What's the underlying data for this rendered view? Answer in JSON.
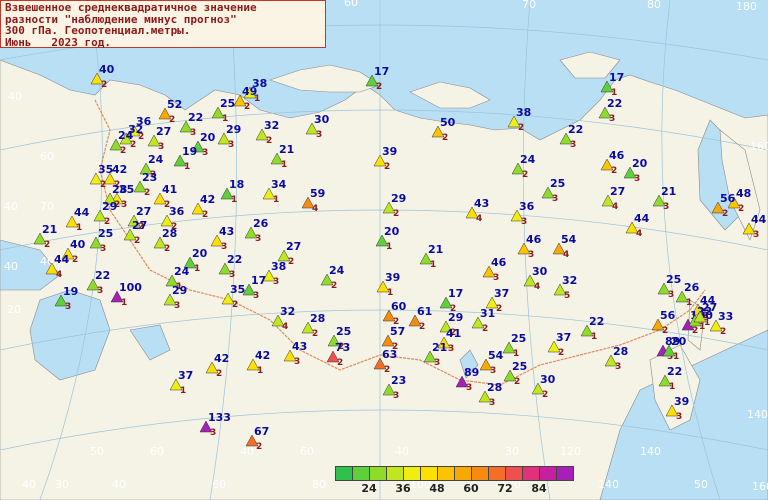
{
  "title": {
    "line1": "Взвешенное среднеквадратичное значение",
    "line2": "разности \"наблюдение минус прогноз\"",
    "line3": "300 гПа. Геопотенциал.метры.",
    "line4": "Июнь   2023 год."
  },
  "legend": {
    "colors": [
      "#2fc24a",
      "#5ed03a",
      "#8fdb2a",
      "#bfe61e",
      "#eeee10",
      "#fde000",
      "#fcc300",
      "#f9a800",
      "#f78b10",
      "#f46e25",
      "#ef4f4f",
      "#e2307a",
      "#c81fa0",
      "#a81fb8"
    ],
    "labels": [
      "24",
      "36",
      "48",
      "60",
      "72",
      "84"
    ]
  },
  "graticule_labels": [
    "60",
    "20",
    "70",
    "80",
    "180",
    "160",
    "140",
    "160",
    "40",
    "40",
    "40",
    "60",
    "40",
    "30",
    "20",
    "40",
    "60",
    "80",
    "100",
    "120",
    "140",
    "50",
    "60",
    "70",
    "40",
    "50",
    "60",
    "40",
    "60",
    "40",
    "30",
    "120",
    "140"
  ],
  "stations": [
    {
      "v": "40",
      "c": "2"
    },
    {
      "v": "52",
      "c": "2"
    },
    {
      "v": "25",
      "c": "1"
    },
    {
      "v": "38",
      "c": "1"
    },
    {
      "v": "49",
      "c": "2"
    },
    {
      "v": "17",
      "c": "2"
    },
    {
      "v": "17",
      "c": "1"
    },
    {
      "v": "36",
      "c": "2"
    },
    {
      "v": "22",
      "c": "3"
    },
    {
      "v": "32",
      "c": "2"
    },
    {
      "v": "27",
      "c": "3"
    },
    {
      "v": "20",
      "c": "3"
    },
    {
      "v": "29",
      "c": "3"
    },
    {
      "v": "30",
      "c": "3"
    },
    {
      "v": "38",
      "c": "2"
    },
    {
      "v": "50",
      "c": "2"
    },
    {
      "v": "22",
      "c": "3"
    },
    {
      "v": "22",
      "c": "3"
    },
    {
      "v": "32",
      "c": "2"
    },
    {
      "v": "24",
      "c": "2"
    },
    {
      "v": "24",
      "c": "2"
    },
    {
      "v": "19",
      "c": "1"
    },
    {
      "v": "21",
      "c": "1"
    },
    {
      "v": "39",
      "c": "2"
    },
    {
      "v": "24",
      "c": "2"
    },
    {
      "v": "46",
      "c": "2"
    },
    {
      "v": "20",
      "c": "3"
    },
    {
      "v": "42",
      "c": "2"
    },
    {
      "v": "35",
      "c": "2"
    },
    {
      "v": "23",
      "c": "2"
    },
    {
      "v": "41",
      "c": "2"
    },
    {
      "v": "18",
      "c": "1"
    },
    {
      "v": "34",
      "c": "1"
    },
    {
      "v": "25",
      "c": "3"
    },
    {
      "v": "35",
      "c": "3"
    },
    {
      "v": "28",
      "c": "2"
    },
    {
      "v": "27",
      "c": "4"
    },
    {
      "v": "21",
      "c": "3"
    },
    {
      "v": "48",
      "c": "2"
    },
    {
      "v": "59",
      "c": "4"
    },
    {
      "v": "29",
      "c": "2"
    },
    {
      "v": "56",
      "c": "2"
    },
    {
      "v": "29",
      "c": "2"
    },
    {
      "v": "42",
      "c": "2"
    },
    {
      "v": "43",
      "c": "4"
    },
    {
      "v": "36",
      "c": "3"
    },
    {
      "v": "44",
      "c": "4"
    },
    {
      "v": "44",
      "c": "1"
    },
    {
      "v": "27",
      "c": "2"
    },
    {
      "v": "36",
      "c": "2"
    },
    {
      "v": "44",
      "c": "3"
    },
    {
      "v": "21",
      "c": "2"
    },
    {
      "v": "40",
      "c": "2"
    },
    {
      "v": "25",
      "c": "3"
    },
    {
      "v": "27",
      "c": "2"
    },
    {
      "v": "28",
      "c": "2"
    },
    {
      "v": "43",
      "c": "3"
    },
    {
      "v": "20",
      "c": "1"
    },
    {
      "v": "21",
      "c": "1"
    },
    {
      "v": "46",
      "c": "3"
    },
    {
      "v": "54",
      "c": "4"
    },
    {
      "v": "26",
      "c": "3"
    },
    {
      "v": "44",
      "c": "4"
    },
    {
      "v": "20",
      "c": "1"
    },
    {
      "v": "27",
      "c": "2"
    },
    {
      "v": "22",
      "c": "3"
    },
    {
      "v": "24",
      "c": "1"
    },
    {
      "v": "38",
      "c": "3"
    },
    {
      "v": "22",
      "c": "3"
    },
    {
      "v": "24",
      "c": "2"
    },
    {
      "v": "39",
      "c": "1"
    },
    {
      "v": "46",
      "c": "3"
    },
    {
      "v": "30",
      "c": "4"
    },
    {
      "v": "32",
      "c": "5"
    },
    {
      "v": "25",
      "c": "3"
    },
    {
      "v": "26",
      "c": "1"
    },
    {
      "v": "19",
      "c": "3"
    },
    {
      "v": "100",
      "c": "1"
    },
    {
      "v": "29",
      "c": "3"
    },
    {
      "v": "35",
      "c": "2"
    },
    {
      "v": "17",
      "c": "3"
    },
    {
      "v": "17",
      "c": "2"
    },
    {
      "v": "37",
      "c": "2"
    },
    {
      "v": "44",
      "c": "2"
    },
    {
      "v": "32",
      "c": "4"
    },
    {
      "v": "60",
      "c": "2"
    },
    {
      "v": "61",
      "c": "2"
    },
    {
      "v": "29",
      "c": "2"
    },
    {
      "v": "31",
      "c": "2"
    },
    {
      "v": "56",
      "c": "2"
    },
    {
      "v": "100",
      "c": "2"
    },
    {
      "v": "33",
      "c": "2"
    },
    {
      "v": "28",
      "c": "2"
    },
    {
      "v": "25",
      "c": "2"
    },
    {
      "v": "57",
      "c": "2"
    },
    {
      "v": "41",
      "c": "3"
    },
    {
      "v": "25",
      "c": "1"
    },
    {
      "v": "37",
      "c": "2"
    },
    {
      "v": "22",
      "c": "1"
    },
    {
      "v": "89",
      "c": "3"
    },
    {
      "v": "43",
      "c": "3"
    },
    {
      "v": "73",
      "c": "2"
    },
    {
      "v": "63",
      "c": "2"
    },
    {
      "v": "21",
      "c": "3"
    },
    {
      "v": "54",
      "c": "3"
    },
    {
      "v": "28",
      "c": "3"
    },
    {
      "v": "42",
      "c": "2"
    },
    {
      "v": "42",
      "c": "1"
    },
    {
      "v": "22",
      "c": "1"
    },
    {
      "v": "25",
      "c": "2"
    },
    {
      "v": "37",
      "c": "1"
    },
    {
      "v": "23",
      "c": "3"
    },
    {
      "v": "89",
      "c": "3"
    },
    {
      "v": "28",
      "c": "3"
    },
    {
      "v": "30",
      "c": "2"
    },
    {
      "v": "39",
      "c": "3"
    },
    {
      "v": "133",
      "c": "3"
    },
    {
      "v": "67",
      "c": "2"
    },
    {
      "v": "20",
      "c": "1"
    },
    {
      "v": "22",
      "c": "1"
    },
    {
      "v": "27",
      "c": "1"
    }
  ]
}
